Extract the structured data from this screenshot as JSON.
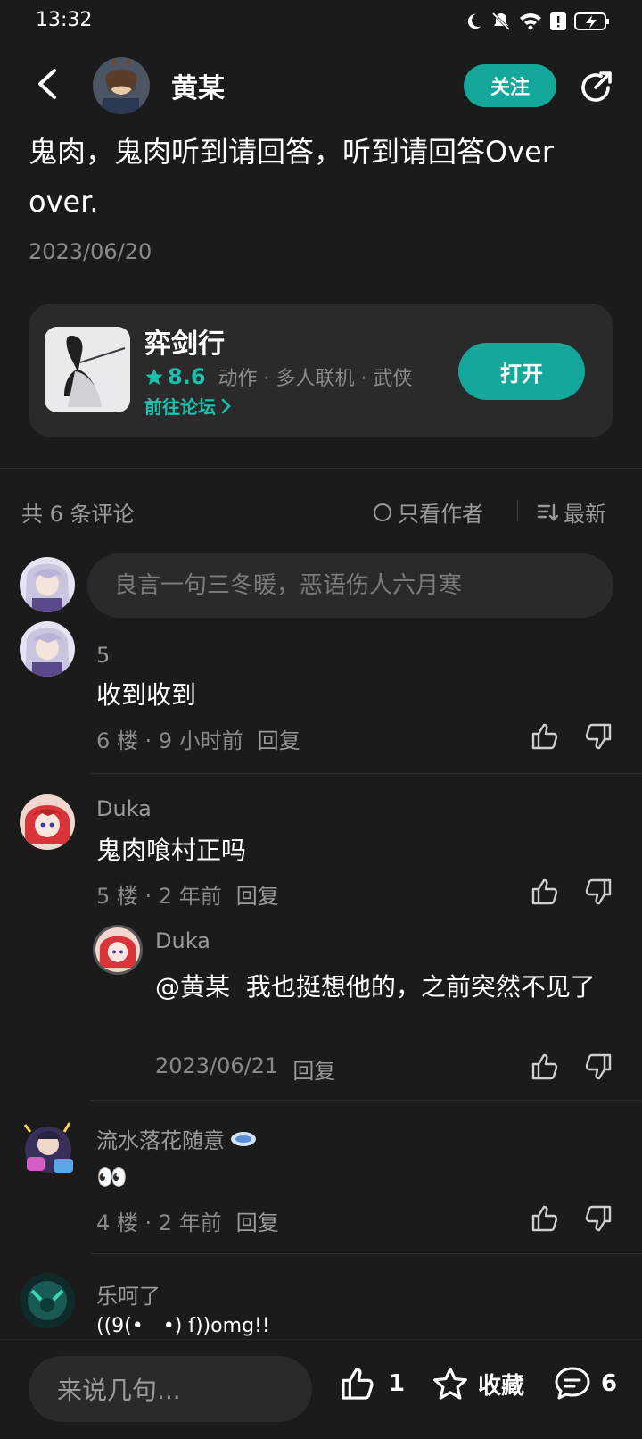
{
  "status_bar": {
    "time": "13:32"
  },
  "header": {
    "author_name": "黄某",
    "follow_label": "关注"
  },
  "post": {
    "text": "鬼肉，鬼肉听到请回答，听到请回答Over over.",
    "date": "2023/06/20"
  },
  "game_card": {
    "name": "弈剑行",
    "rating": "8.6",
    "tags": "动作 · 多人联机 · 武侠",
    "forum_link": "前往论坛",
    "open_label": "打开"
  },
  "comments_header": {
    "count_text": "共 6 条评论",
    "author_only_label": "只看作者",
    "sort_label": "最新"
  },
  "comment_input": {
    "placeholder": "良言一句三冬暖，恶语伤人六月寒"
  },
  "comments": [
    {
      "user": "5",
      "text": "收到收到",
      "floor": "6 楼",
      "time": "9 小时前",
      "reply_label": "回复"
    },
    {
      "user": "Duka",
      "text": "鬼肉喰村正吗",
      "floor": "5 楼",
      "time": "2 年前",
      "reply_label": "回复",
      "sub_reply": {
        "user": "Duka",
        "mention": "@黄某",
        "text": "我也挺想他的，之前突然不见了",
        "date": "2023/06/21",
        "reply_label": "回复"
      }
    },
    {
      "user": "流水落花随意",
      "text": "👀",
      "floor": "4 楼",
      "time": "2 年前",
      "reply_label": "回复"
    },
    {
      "user": "乐呵了",
      "text": "((9(•　•) ſ))omg!!"
    }
  ],
  "bottom_bar": {
    "input_placeholder": "来说几句...",
    "like_count": "1",
    "favorite_label": "收藏",
    "comment_count": "6"
  },
  "colors": {
    "accent": "#13a89b",
    "background": "#1b1b1b",
    "card": "#2a2a2a"
  }
}
